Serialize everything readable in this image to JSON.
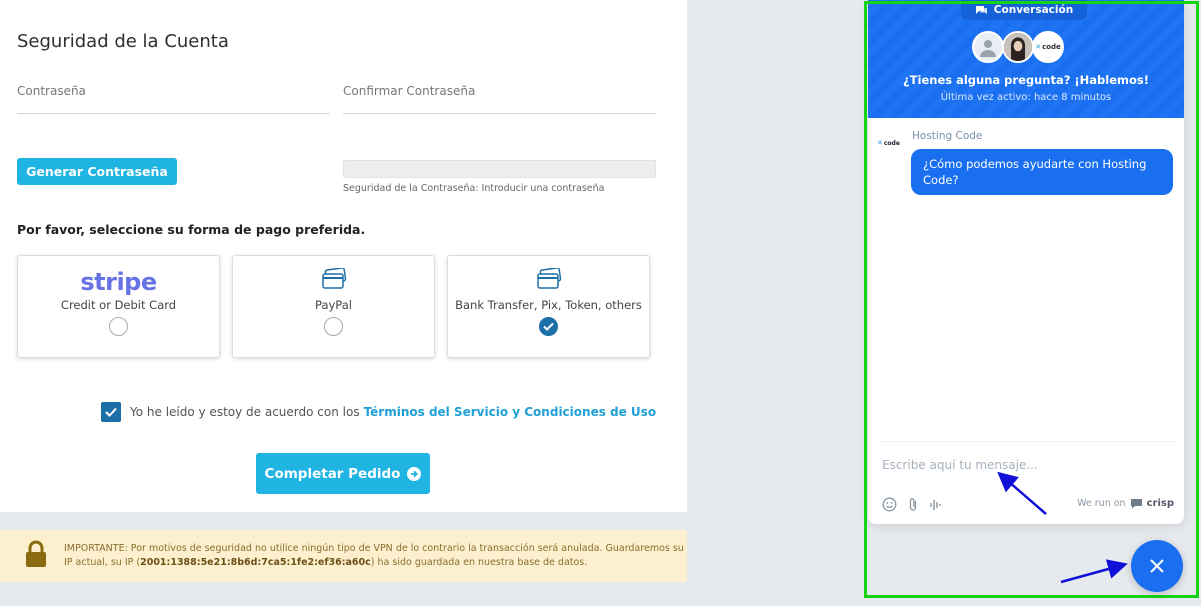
{
  "account": {
    "title": "Seguridad de la Cuenta",
    "password_label": "Contraseña",
    "confirm_label": "Confirmar Contraseña",
    "generate_button": "Generar Contraseña",
    "strength_text": "Seguridad de la Contraseña: Introducir una contraseña"
  },
  "payment": {
    "heading": "Por favor, seleccione su forma de pago preferida.",
    "options": [
      {
        "logo": "stripe",
        "label": "Credit or Debit Card",
        "selected": false
      },
      {
        "label": "PayPal",
        "icon": "credit-card-icon",
        "selected": false
      },
      {
        "label": "Bank Transfer, Pix, Token, others",
        "icon": "credit-card-icon",
        "selected": true
      }
    ]
  },
  "tos": {
    "text": "Yo he leído y estoy de acuerdo con los",
    "link": "Términos del Servicio y Condiciones de Uso",
    "checked": true
  },
  "complete_button": "Completar Pedido",
  "warning": {
    "text_before": "IMPORTANTE: Por motivos de seguridad no utilice ningún tipo de VPN de lo contrario la transacción será anulada. Guardaremos su IP actual, su IP (",
    "ip": "2001:1388:5e21:8b6d:7ca5:1fe2:ef36:a60c",
    "text_after": ") ha sido guardada en nuestra base de datos."
  },
  "chat": {
    "tab_label": "Conversación",
    "headline": "¿Tienes alguna pregunta? ¡Hablemos!",
    "last_active": "Última vez activo: hace 8 minutos",
    "avatar_code_label": "code",
    "operator_name": "Hosting Code",
    "operator_logo": "code",
    "message": "¿Cómo podemos ayudarte con Hosting Code?",
    "input_placeholder": "Escribe aquí tu mensaje...",
    "run_on": "We run on",
    "brand": "crisp"
  },
  "colors": {
    "accent": "#1fb4e2",
    "chat_blue": "#1a6ff0",
    "checked_blue": "#1d6fa8",
    "highlight_green": "#17d317",
    "arrow_blue": "#1010d8",
    "warning_bg": "#fcf0cf"
  }
}
